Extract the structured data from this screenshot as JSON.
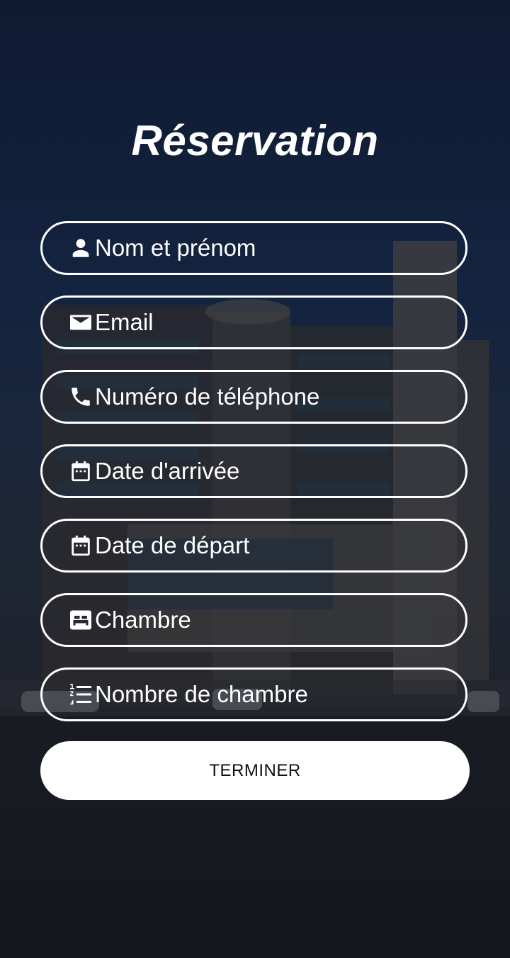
{
  "title": "Réservation",
  "fields": [
    {
      "icon": "person-icon",
      "label": "Nom et prénom"
    },
    {
      "icon": "email-icon",
      "label": "Email"
    },
    {
      "icon": "phone-icon",
      "label": "Numéro de téléphone"
    },
    {
      "icon": "calendar-icon",
      "label": "Date d'arrivée"
    },
    {
      "icon": "calendar-icon",
      "label": "Date de départ"
    },
    {
      "icon": "bed-icon",
      "label": "Chambre"
    },
    {
      "icon": "numbered-list-icon",
      "label": "Nombre de chambre"
    }
  ],
  "submit": {
    "label": "TERMINER"
  },
  "colors": {
    "text": "#ffffff",
    "button_bg": "#ffffff",
    "button_text": "#111111"
  }
}
